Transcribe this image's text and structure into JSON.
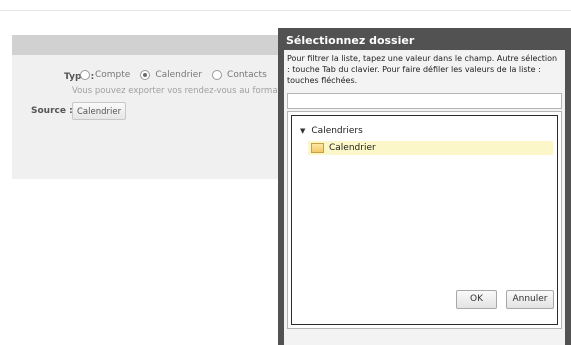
{
  "background": {
    "type_label": "Type :",
    "options": [
      {
        "label": "Compte",
        "checked": false
      },
      {
        "label": "Calendrier",
        "checked": true
      },
      {
        "label": "Contacts",
        "checked": false
      }
    ],
    "hint": "Vous pouvez exporter vos rendez-vous au format",
    "source_label": "Source :",
    "source_button": "Calendrier"
  },
  "dialog": {
    "title": "Sélectionnez dossier",
    "instructions": "Pour filtrer la liste, tapez une valeur dans le champ. Autre sélection : touche Tab du clavier. Pour faire défiler les valeurs de la liste : touches fléchées.",
    "filter_value": "",
    "tree": {
      "root": {
        "label": "Calendriers",
        "icon": "triangle-down-icon"
      },
      "children": [
        {
          "label": "Calendrier",
          "icon": "folder-icon",
          "selected": true
        }
      ]
    },
    "ok_label": "OK",
    "cancel_label": "Annuler"
  },
  "colors": {
    "dialog_frame": "#525252",
    "selection": "#fbf7c8"
  }
}
